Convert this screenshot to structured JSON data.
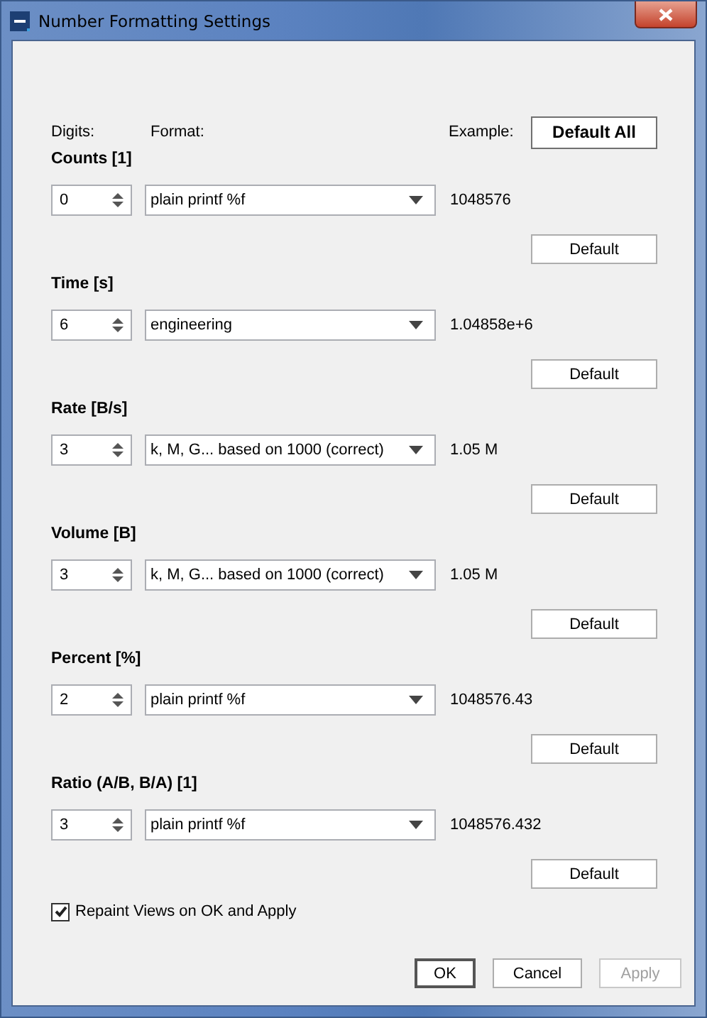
{
  "window": {
    "title": "Number Formatting Settings"
  },
  "header": {
    "digits_label": "Digits:",
    "format_label": "Format:",
    "example_label": "Example:",
    "default_all_button": "Default All"
  },
  "sections": [
    {
      "title": "Counts [1]",
      "digits": "0",
      "format": "plain printf %f",
      "example": "1048576",
      "default_button": "Default"
    },
    {
      "title": "Time [s]",
      "digits": "6",
      "format": "engineering",
      "example": "1.04858e+6",
      "default_button": "Default"
    },
    {
      "title": "Rate [B/s]",
      "digits": "3",
      "format": "k, M, G... based on 1000 (correct)",
      "example": "1.05 M",
      "default_button": "Default"
    },
    {
      "title": "Volume [B]",
      "digits": "3",
      "format": "k, M, G... based on 1000 (correct)",
      "example": "1.05 M",
      "default_button": "Default"
    },
    {
      "title": "Percent [%]",
      "digits": "2",
      "format": "plain printf %f",
      "example": "1048576.43",
      "default_button": "Default"
    },
    {
      "title": "Ratio (A/B, B/A) [1]",
      "digits": "3",
      "format": "plain printf %f",
      "example": "1048576.432",
      "default_button": "Default"
    }
  ],
  "repaint": {
    "label": "Repaint Views on OK and Apply",
    "checked": true
  },
  "buttons": [
    {
      "label": "OK",
      "kind": "default",
      "disabled": false
    },
    {
      "label": "Cancel",
      "kind": "normal",
      "disabled": false
    },
    {
      "label": "Apply",
      "kind": "normal",
      "disabled": true
    }
  ]
}
